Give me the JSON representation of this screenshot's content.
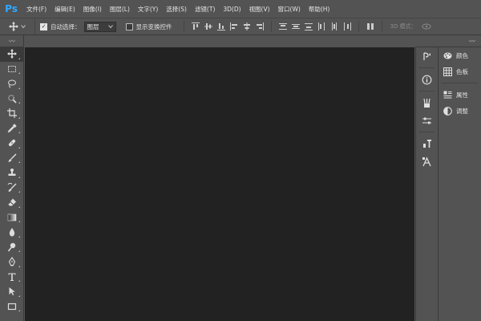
{
  "app": {
    "logo": "Ps"
  },
  "menu": [
    "文件(F)",
    "编辑(E)",
    "图像(I)",
    "图层(L)",
    "文字(Y)",
    "选择(S)",
    "滤镜(T)",
    "3D(D)",
    "视图(V)",
    "窗口(W)",
    "帮助(H)"
  ],
  "options": {
    "auto_select_label": "自动选择：",
    "auto_select_value": "图层",
    "show_transform_label": "显示变换控件",
    "mode_label": "3D 模式："
  },
  "panels": {
    "color_label": "颜色",
    "swatches_label": "色板",
    "properties_label": "属性",
    "adjustments_label": "调整"
  },
  "colors": {
    "chrome": "#535353",
    "canvas": "#222222",
    "ps_blue": "#31a8ff"
  }
}
